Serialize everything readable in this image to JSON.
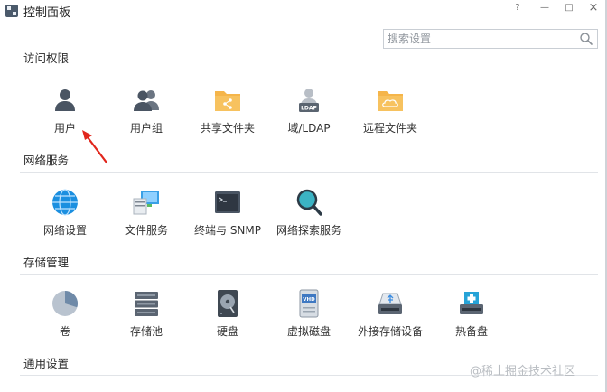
{
  "window": {
    "title": "控制面板",
    "help_glyph": "?",
    "minimize_glyph": "—",
    "maximize_glyph": "□",
    "close_glyph": "×"
  },
  "search": {
    "placeholder": "搜索设置",
    "value": ""
  },
  "sections": [
    {
      "title": "访问权限",
      "items": [
        {
          "label": "用户",
          "icon": "user-icon"
        },
        {
          "label": "用户组",
          "icon": "user-group-icon"
        },
        {
          "label": "共享文件夹",
          "icon": "shared-folder-icon"
        },
        {
          "label": "域/LDAP",
          "icon": "ldap-icon"
        },
        {
          "label": "远程文件夹",
          "icon": "remote-folder-icon"
        }
      ]
    },
    {
      "title": "网络服务",
      "items": [
        {
          "label": "网络设置",
          "icon": "globe-icon"
        },
        {
          "label": "文件服务",
          "icon": "file-service-icon"
        },
        {
          "label": "终端与 SNMP",
          "icon": "terminal-icon"
        },
        {
          "label": "网络探索服务",
          "icon": "network-discovery-icon"
        }
      ]
    },
    {
      "title": "存储管理",
      "items": [
        {
          "label": "卷",
          "icon": "volume-pie-icon"
        },
        {
          "label": "存储池",
          "icon": "storage-pool-icon"
        },
        {
          "label": "硬盘",
          "icon": "hard-disk-icon"
        },
        {
          "label": "虚拟磁盘",
          "icon": "virtual-disk-icon"
        },
        {
          "label": "外接存储设备",
          "icon": "usb-storage-icon"
        },
        {
          "label": "热备盘",
          "icon": "hot-spare-icon"
        }
      ]
    },
    {
      "title": "通用设置",
      "items": []
    }
  ],
  "watermark": "@稀土掘金技术社区",
  "colors": {
    "folder": "#f5b54a",
    "globe": "#1b8fe0",
    "dark_icon": "#4a5563",
    "accent_arrow": "#e1261c"
  }
}
